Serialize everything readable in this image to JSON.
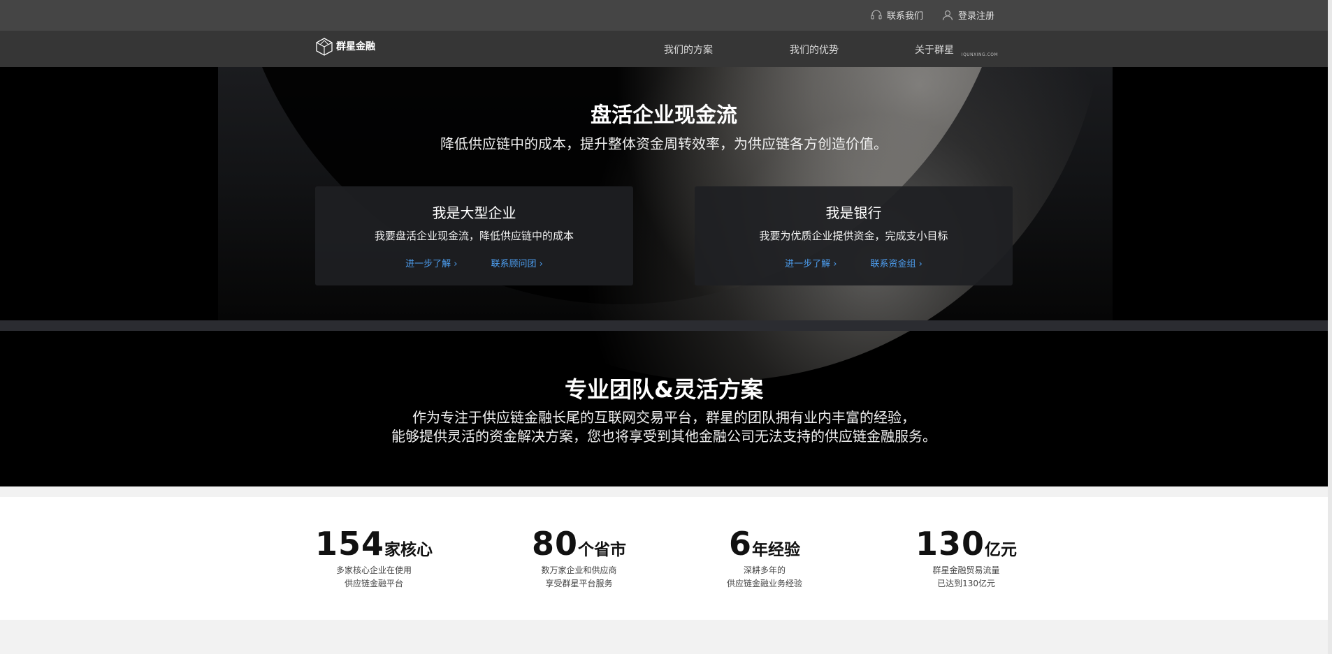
{
  "topbar": {
    "contact": {
      "icon": "headset-icon",
      "label": "联系我们"
    },
    "login": {
      "icon": "user-icon",
      "label": "登录注册"
    }
  },
  "nav": {
    "logo": {
      "name": "群星金融",
      "sub": "IQUNXING.COM"
    },
    "items": [
      {
        "label": "我们的方案"
      },
      {
        "label": "我们的优势"
      },
      {
        "label": "关于群星"
      }
    ]
  },
  "hero": {
    "title": "盘活企业现金流",
    "subtitle": "降低供应链中的成本，提升整体资金周转效率，为供应链各方创造价值。",
    "cards": [
      {
        "title": "我是大型企业",
        "desc": "我要盘活企业现金流，降低供应链中的成本",
        "link1": "进一步了解 ›",
        "link2": "联系顾问团 ›"
      },
      {
        "title": "我是银行",
        "desc": "我要为优质企业提供资金，完成支小目标",
        "link1": "进一步了解 ›",
        "link2": "联系资金组 ›"
      }
    ]
  },
  "team": {
    "title": "专业团队&灵活方案",
    "line1": "作为专注于供应链金融长尾的互联网交易平台，群星的团队拥有业内丰富的经验，",
    "line2": "能够提供灵活的资金解决方案，您也将享受到其他金融公司无法支持的供应链金融服务。"
  },
  "stats": [
    {
      "number": "154",
      "unit": "家核心",
      "desc1": "多家核心企业在使用",
      "desc2": "供应链金融平台"
    },
    {
      "number": "80",
      "unit": "个省市",
      "desc1": "数万家企业和供应商",
      "desc2": "享受群星平台服务"
    },
    {
      "number": "6",
      "unit": "年经验",
      "desc1": "深耕多年的",
      "desc2": "供应链金融业务经验"
    },
    {
      "number": "130",
      "unit": "亿元",
      "desc1": "群星金融贸易流量",
      "desc2": "已达到130亿元"
    }
  ],
  "colors": {
    "link": "#4d9ef0",
    "topbar": "#454545",
    "nav": "#363636"
  }
}
